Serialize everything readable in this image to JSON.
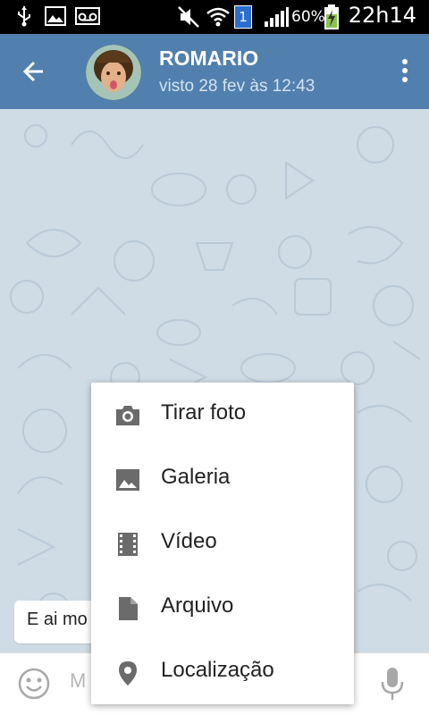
{
  "status_bar": {
    "time": "22h14",
    "battery_percent": "60%",
    "notification_count": "1",
    "icons": [
      "usb-icon",
      "image-notification-icon",
      "voicemail-icon",
      "mute-icon",
      "wifi-icon",
      "signal-icon",
      "battery-charging-icon"
    ]
  },
  "header": {
    "contact_name": "ROMARIO",
    "last_seen": "visto 28 fev às 12:43",
    "color": "#5180ae"
  },
  "chat": {
    "message_preview": "E ai mo",
    "background_color": "#cfdbe5"
  },
  "input": {
    "placeholder": "M"
  },
  "attach_menu": {
    "items": [
      {
        "label": "Tirar foto",
        "icon": "camera-icon"
      },
      {
        "label": "Galeria",
        "icon": "gallery-icon"
      },
      {
        "label": "Vídeo",
        "icon": "video-icon"
      },
      {
        "label": "Arquivo",
        "icon": "file-icon"
      },
      {
        "label": "Localização",
        "icon": "location-icon"
      }
    ]
  }
}
